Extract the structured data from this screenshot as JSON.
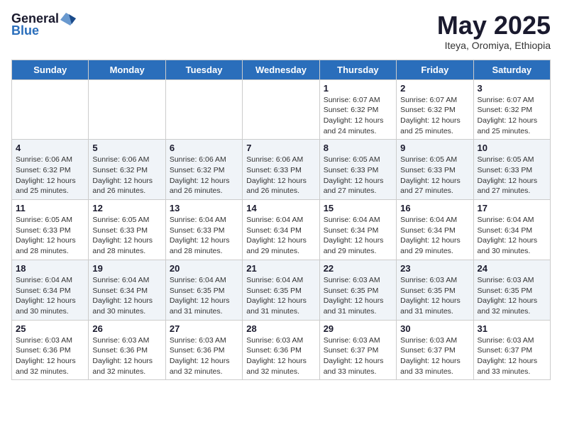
{
  "header": {
    "logo_general": "General",
    "logo_blue": "Blue",
    "month": "May 2025",
    "location": "Iteya, Oromiya, Ethiopia"
  },
  "days_of_week": [
    "Sunday",
    "Monday",
    "Tuesday",
    "Wednesday",
    "Thursday",
    "Friday",
    "Saturday"
  ],
  "weeks": [
    [
      {
        "day": "",
        "info": ""
      },
      {
        "day": "",
        "info": ""
      },
      {
        "day": "",
        "info": ""
      },
      {
        "day": "",
        "info": ""
      },
      {
        "day": "1",
        "info": "Sunrise: 6:07 AM\nSunset: 6:32 PM\nDaylight: 12 hours\nand 24 minutes."
      },
      {
        "day": "2",
        "info": "Sunrise: 6:07 AM\nSunset: 6:32 PM\nDaylight: 12 hours\nand 25 minutes."
      },
      {
        "day": "3",
        "info": "Sunrise: 6:07 AM\nSunset: 6:32 PM\nDaylight: 12 hours\nand 25 minutes."
      }
    ],
    [
      {
        "day": "4",
        "info": "Sunrise: 6:06 AM\nSunset: 6:32 PM\nDaylight: 12 hours\nand 25 minutes."
      },
      {
        "day": "5",
        "info": "Sunrise: 6:06 AM\nSunset: 6:32 PM\nDaylight: 12 hours\nand 26 minutes."
      },
      {
        "day": "6",
        "info": "Sunrise: 6:06 AM\nSunset: 6:32 PM\nDaylight: 12 hours\nand 26 minutes."
      },
      {
        "day": "7",
        "info": "Sunrise: 6:06 AM\nSunset: 6:33 PM\nDaylight: 12 hours\nand 26 minutes."
      },
      {
        "day": "8",
        "info": "Sunrise: 6:05 AM\nSunset: 6:33 PM\nDaylight: 12 hours\nand 27 minutes."
      },
      {
        "day": "9",
        "info": "Sunrise: 6:05 AM\nSunset: 6:33 PM\nDaylight: 12 hours\nand 27 minutes."
      },
      {
        "day": "10",
        "info": "Sunrise: 6:05 AM\nSunset: 6:33 PM\nDaylight: 12 hours\nand 27 minutes."
      }
    ],
    [
      {
        "day": "11",
        "info": "Sunrise: 6:05 AM\nSunset: 6:33 PM\nDaylight: 12 hours\nand 28 minutes."
      },
      {
        "day": "12",
        "info": "Sunrise: 6:05 AM\nSunset: 6:33 PM\nDaylight: 12 hours\nand 28 minutes."
      },
      {
        "day": "13",
        "info": "Sunrise: 6:04 AM\nSunset: 6:33 PM\nDaylight: 12 hours\nand 28 minutes."
      },
      {
        "day": "14",
        "info": "Sunrise: 6:04 AM\nSunset: 6:34 PM\nDaylight: 12 hours\nand 29 minutes."
      },
      {
        "day": "15",
        "info": "Sunrise: 6:04 AM\nSunset: 6:34 PM\nDaylight: 12 hours\nand 29 minutes."
      },
      {
        "day": "16",
        "info": "Sunrise: 6:04 AM\nSunset: 6:34 PM\nDaylight: 12 hours\nand 29 minutes."
      },
      {
        "day": "17",
        "info": "Sunrise: 6:04 AM\nSunset: 6:34 PM\nDaylight: 12 hours\nand 30 minutes."
      }
    ],
    [
      {
        "day": "18",
        "info": "Sunrise: 6:04 AM\nSunset: 6:34 PM\nDaylight: 12 hours\nand 30 minutes."
      },
      {
        "day": "19",
        "info": "Sunrise: 6:04 AM\nSunset: 6:34 PM\nDaylight: 12 hours\nand 30 minutes."
      },
      {
        "day": "20",
        "info": "Sunrise: 6:04 AM\nSunset: 6:35 PM\nDaylight: 12 hours\nand 31 minutes."
      },
      {
        "day": "21",
        "info": "Sunrise: 6:04 AM\nSunset: 6:35 PM\nDaylight: 12 hours\nand 31 minutes."
      },
      {
        "day": "22",
        "info": "Sunrise: 6:03 AM\nSunset: 6:35 PM\nDaylight: 12 hours\nand 31 minutes."
      },
      {
        "day": "23",
        "info": "Sunrise: 6:03 AM\nSunset: 6:35 PM\nDaylight: 12 hours\nand 31 minutes."
      },
      {
        "day": "24",
        "info": "Sunrise: 6:03 AM\nSunset: 6:35 PM\nDaylight: 12 hours\nand 32 minutes."
      }
    ],
    [
      {
        "day": "25",
        "info": "Sunrise: 6:03 AM\nSunset: 6:36 PM\nDaylight: 12 hours\nand 32 minutes."
      },
      {
        "day": "26",
        "info": "Sunrise: 6:03 AM\nSunset: 6:36 PM\nDaylight: 12 hours\nand 32 minutes."
      },
      {
        "day": "27",
        "info": "Sunrise: 6:03 AM\nSunset: 6:36 PM\nDaylight: 12 hours\nand 32 minutes."
      },
      {
        "day": "28",
        "info": "Sunrise: 6:03 AM\nSunset: 6:36 PM\nDaylight: 12 hours\nand 32 minutes."
      },
      {
        "day": "29",
        "info": "Sunrise: 6:03 AM\nSunset: 6:37 PM\nDaylight: 12 hours\nand 33 minutes."
      },
      {
        "day": "30",
        "info": "Sunrise: 6:03 AM\nSunset: 6:37 PM\nDaylight: 12 hours\nand 33 minutes."
      },
      {
        "day": "31",
        "info": "Sunrise: 6:03 AM\nSunset: 6:37 PM\nDaylight: 12 hours\nand 33 minutes."
      }
    ]
  ]
}
